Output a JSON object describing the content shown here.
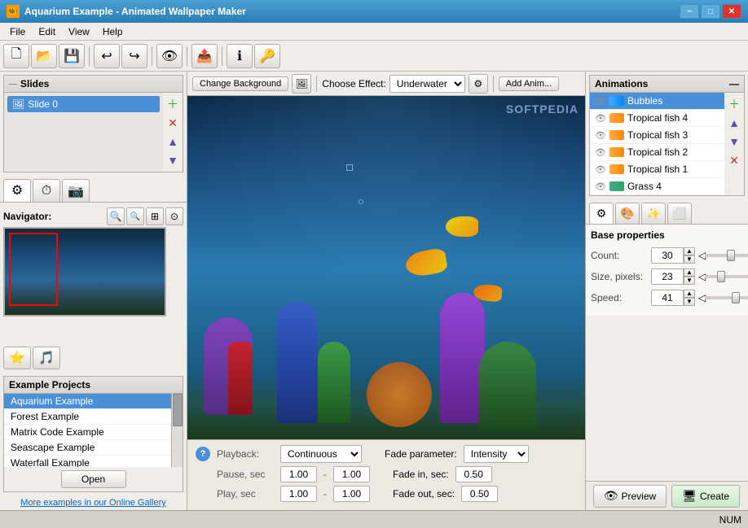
{
  "window": {
    "title": "Aquarium Example - Animated Wallpaper Maker",
    "icon": "🐠"
  },
  "titlebar": {
    "minimize": "−",
    "maximize": "□",
    "close": "✕"
  },
  "menu": {
    "items": [
      "File",
      "Edit",
      "View",
      "Help"
    ]
  },
  "slides": {
    "section_title": "Slides",
    "items": [
      {
        "label": "Slide 0"
      }
    ],
    "add_btn": "+",
    "remove_btn": "✕",
    "up_btn": "▲",
    "down_btn": "▼"
  },
  "navigator": {
    "label": "Navigator:",
    "zoom_in": "🔍+",
    "zoom_out": "🔍−",
    "fit": "⊡",
    "reset": "◎"
  },
  "example_projects": {
    "title": "Example Projects",
    "items": [
      {
        "label": "Aquarium Example",
        "selected": true
      },
      {
        "label": "Forest Example"
      },
      {
        "label": "Matrix Code Example"
      },
      {
        "label": "Seascape Example"
      },
      {
        "label": "Waterfall Example"
      }
    ],
    "open_btn": "Open",
    "gallery_link": "More examples in our Online Gallery"
  },
  "effect_bar": {
    "change_bg": "Change Background",
    "choose_effect": "Choose Effect:",
    "effect_value": "Underwater",
    "add_anim": "Add Anim..."
  },
  "animations": {
    "section_title": "Animations",
    "items": [
      {
        "label": "Bubbles",
        "selected": true,
        "thumb": "blue"
      },
      {
        "label": "Tropical fish 4",
        "thumb": "orange"
      },
      {
        "label": "Tropical fish 3",
        "thumb": "orange"
      },
      {
        "label": "Tropical fish 2",
        "thumb": "orange"
      },
      {
        "label": "Tropical fish 1",
        "thumb": "orange"
      },
      {
        "label": "Grass 4",
        "thumb": "green"
      }
    ],
    "add_btn": "+",
    "up_btn": "▲",
    "down_btn": "▼",
    "remove_btn": "✕"
  },
  "properties": {
    "title": "Base properties",
    "count_label": "Count:",
    "count_value": "30",
    "size_label": "Size, pixels:",
    "size_value": "23",
    "speed_label": "Speed:",
    "speed_value": "41",
    "count_slider_pos": "50",
    "size_slider_pos": "30",
    "speed_slider_pos": "60"
  },
  "playback": {
    "label": "Playback:",
    "value": "Continuous",
    "pause_label": "Pause, sec",
    "pause_from": "1.00",
    "pause_to": "1.00",
    "play_label": "Play, sec",
    "play_from": "1.00",
    "play_to": "1.00",
    "fade_param_label": "Fade parameter:",
    "fade_param_value": "Intensity",
    "fade_in_label": "Fade in, sec:",
    "fade_in_value": "0.50",
    "fade_out_label": "Fade out, sec:",
    "fade_out_value": "0.50"
  },
  "actions": {
    "preview_label": "Preview",
    "create_label": "Create"
  },
  "statusbar": {
    "text": "NUM"
  }
}
